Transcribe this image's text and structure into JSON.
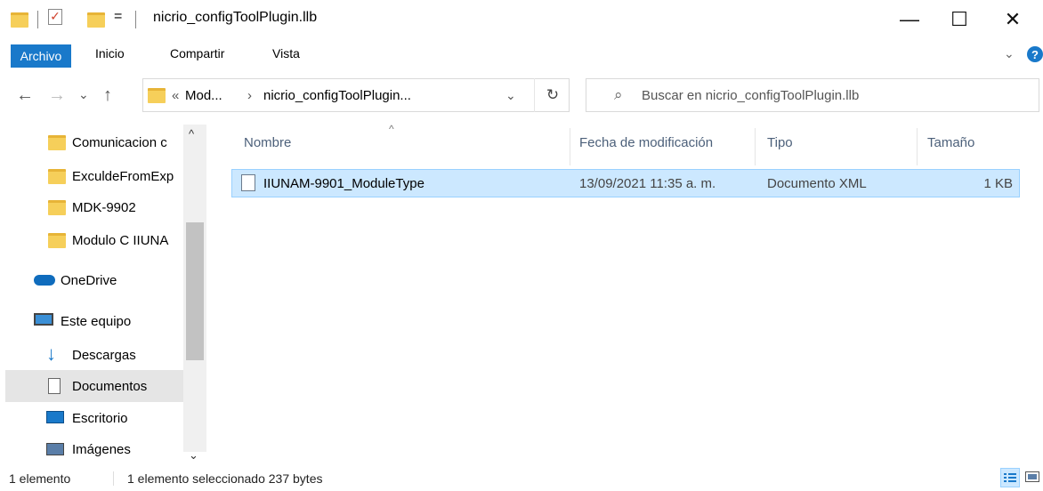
{
  "window": {
    "title": "nicrio_configToolPlugin.llb",
    "qat_dropdown": "=",
    "minimize": "—",
    "maximize": "☐",
    "close": "✕"
  },
  "ribbon": {
    "tabs": [
      "Archivo",
      "Inicio",
      "Compartir",
      "Vista"
    ],
    "help": "?",
    "collapse": "⌄"
  },
  "address": {
    "prefix": "«",
    "crumb1": "Mod...",
    "arrow": "›",
    "crumb2": "nicrio_configToolPlugin...",
    "dropdown": "⌄",
    "refresh": "↻"
  },
  "nav": {
    "back": "←",
    "forward": "→",
    "recent": "⌄",
    "up": "↑"
  },
  "search": {
    "placeholder": "Buscar en nicrio_configToolPlugin.llb",
    "icon": "⌕"
  },
  "sidebar": {
    "items": [
      {
        "label": "Comunicacion c",
        "icon": "folder-icon"
      },
      {
        "label": "ExculdeFromExp",
        "icon": "folder-icon"
      },
      {
        "label": "MDK-9902",
        "icon": "folder-icon"
      },
      {
        "label": "Modulo C IIUNA",
        "icon": "folder-icon"
      },
      {
        "label": "OneDrive",
        "icon": "cloud-icon"
      },
      {
        "label": "Este equipo",
        "icon": "computer-icon"
      },
      {
        "label": "Descargas",
        "icon": "download-icon"
      },
      {
        "label": "Documentos",
        "icon": "documents-icon"
      },
      {
        "label": "Escritorio",
        "icon": "desktop-icon"
      },
      {
        "label": "Imágenes",
        "icon": "pictures-icon"
      }
    ],
    "scroll_up": "^",
    "scroll_down": "⌄"
  },
  "columns": {
    "name": "Nombre",
    "date": "Fecha de modificación",
    "type": "Tipo",
    "size": "Tamaño",
    "sort_arrow": "^"
  },
  "files": [
    {
      "name": "IIUNAM-9901_ModuleType",
      "date": "13/09/2021 11:35 a. m.",
      "type": "Documento XML",
      "size": "1 KB"
    }
  ],
  "status": {
    "count": "1 elemento",
    "selection": "1 elemento seleccionado  237 bytes"
  },
  "colors": {
    "accent": "#1979ca",
    "selection": "#cce8ff",
    "folder": "#f6cf5a"
  }
}
